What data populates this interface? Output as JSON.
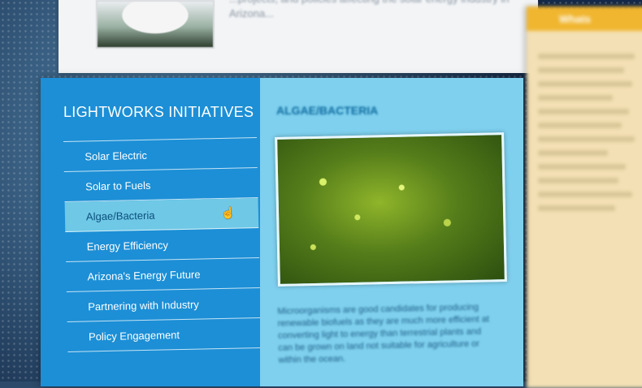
{
  "top": {
    "text": "...projects, and policies affecting the solar energy industry in Arizona..."
  },
  "sidebar": {
    "title": "LIGHTWORKS INITIATIVES",
    "items": [
      {
        "label": "Solar Electric"
      },
      {
        "label": "Solar to Fuels"
      },
      {
        "label": "Algae/Bacteria",
        "active": true
      },
      {
        "label": "Energy Efficiency"
      },
      {
        "label": "Arizona's Energy Future"
      },
      {
        "label": "Partnering with Industry"
      },
      {
        "label": "Policy Engagement"
      }
    ]
  },
  "content": {
    "title": "ALGAE/BACTERIA",
    "body": "Microorganisms are good candidates for producing renewable biofuels as they are much more efficient at converting light to energy than terrestrial plants and can be grown on land not suitable for agriculture or within the ocean."
  },
  "side_panel": {
    "header": "Whats"
  },
  "colors": {
    "nav_bg": "#1c8fd6",
    "nav_active": "#6ec8e6",
    "content_bg": "#7ed0ee",
    "side_header": "#f0b630"
  }
}
